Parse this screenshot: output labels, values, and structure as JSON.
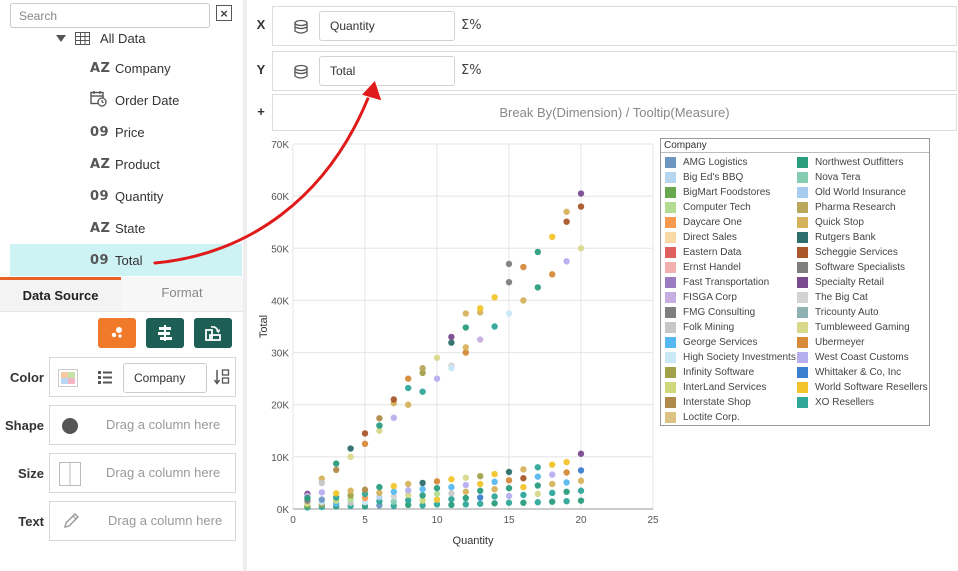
{
  "sidebar": {
    "search_placeholder": "Search",
    "clear_glyph": "×",
    "root_label": "All Data",
    "fields": [
      {
        "icon": "AZ",
        "label": "Company"
      },
      {
        "icon": "cal",
        "label": "Order Date"
      },
      {
        "icon": "09",
        "label": "Price"
      },
      {
        "icon": "AZ",
        "label": "Product"
      },
      {
        "icon": "09",
        "label": "Quantity"
      },
      {
        "icon": "AZ",
        "label": "State"
      },
      {
        "icon": "09",
        "label": "Total"
      }
    ]
  },
  "tabs": {
    "data_source": "Data Source",
    "format": "Format"
  },
  "props": {
    "color_label": "Color",
    "color_value": "Company",
    "shape_label": "Shape",
    "size_label": "Size",
    "text_label": "Text",
    "drag_hint": "Drag a column here"
  },
  "shelves": {
    "x_key": "X",
    "x_value": "Quantity",
    "y_key": "Y",
    "y_value": "Total",
    "plus_key": "+",
    "agg_glyph": "Σ%",
    "breakby": "Break By(Dimension) / Tooltip(Measure)"
  },
  "chart_data": {
    "type": "scatter",
    "xlabel": "Quantity",
    "ylabel": "Total",
    "xlim": [
      0,
      25
    ],
    "ylim": [
      0,
      70000
    ],
    "x_ticks": [
      "0",
      "5",
      "10",
      "15",
      "20",
      "25"
    ],
    "y_ticks": [
      "0K",
      "10K",
      "20K",
      "30K",
      "40K",
      "50K",
      "60K",
      "70K"
    ],
    "grid": true,
    "legend_title": "Company",
    "legend_placement": "right",
    "legend": [
      {
        "name": "AMG Logistics",
        "color": "#6c97c1"
      },
      {
        "name": "Big Ed's BBQ",
        "color": "#b6d5ee"
      },
      {
        "name": "BigMart Foodstores",
        "color": "#6aa84f"
      },
      {
        "name": "Computer Tech",
        "color": "#b3dc93"
      },
      {
        "name": "Daycare One",
        "color": "#f79a52"
      },
      {
        "name": "Direct Sales",
        "color": "#f9d9a6"
      },
      {
        "name": "Eastern Data",
        "color": "#e06060"
      },
      {
        "name": "Ernst Handel",
        "color": "#f2b0ae"
      },
      {
        "name": "Fast Transportation",
        "color": "#9b7cc2"
      },
      {
        "name": "FISGA Corp",
        "color": "#c8aee0"
      },
      {
        "name": "FMG Consulting",
        "color": "#7f7f7f"
      },
      {
        "name": "Folk Mining",
        "color": "#c7c7c7"
      },
      {
        "name": "George Services",
        "color": "#59b8ef"
      },
      {
        "name": "High Society Investments",
        "color": "#c9e9f6"
      },
      {
        "name": "Infinity Software",
        "color": "#a1a14a"
      },
      {
        "name": "InterLand Services",
        "color": "#cfd97c"
      },
      {
        "name": "Interstate Shop",
        "color": "#b08a4a"
      },
      {
        "name": "Loctite Corp.",
        "color": "#dcc383"
      },
      {
        "name": "Northwest Outfitters",
        "color": "#2a9d7f"
      },
      {
        "name": "Nova Tera",
        "color": "#85cdb2"
      },
      {
        "name": "Old World Insurance",
        "color": "#a7ccef"
      },
      {
        "name": "Pharma Research",
        "color": "#b9a85b"
      },
      {
        "name": "Quick Stop",
        "color": "#d6b25c"
      },
      {
        "name": "Rutgers Bank",
        "color": "#2e6e6a"
      },
      {
        "name": "Scheggie Services",
        "color": "#a9572b"
      },
      {
        "name": "Software Specialists",
        "color": "#7e7e7e"
      },
      {
        "name": "Specialty Retail",
        "color": "#7a4c8f"
      },
      {
        "name": "The Big Cat",
        "color": "#d3d3d3"
      },
      {
        "name": "Tricounty Auto",
        "color": "#8fb1b1"
      },
      {
        "name": "Tumbleweed Gaming",
        "color": "#d8d88c"
      },
      {
        "name": "Ubermeyer",
        "color": "#d68a3a"
      },
      {
        "name": "West Coast Customs",
        "color": "#b7aef0"
      },
      {
        "name": "Whittaker & Co, Inc",
        "color": "#3b7fd1"
      },
      {
        "name": "World Software Resellers",
        "color": "#f2c42a"
      },
      {
        "name": "XO Resellers",
        "color": "#2fa89a"
      }
    ],
    "points": [
      {
        "x": 1,
        "y": 2900,
        "c": "#7a4c8f"
      },
      {
        "x": 2,
        "y": 5800,
        "c": "#d6b25c"
      },
      {
        "x": 3,
        "y": 8700,
        "c": "#2a9d7f"
      },
      {
        "x": 4,
        "y": 11600,
        "c": "#2e6e6a"
      },
      {
        "x": 5,
        "y": 14500,
        "c": "#a9572b"
      },
      {
        "x": 6,
        "y": 17400,
        "c": "#b08a4a"
      },
      {
        "x": 7,
        "y": 20300,
        "c": "#d6b25c"
      },
      {
        "x": 8,
        "y": 23200,
        "c": "#2fa89a"
      },
      {
        "x": 9,
        "y": 26100,
        "c": "#a1a14a"
      },
      {
        "x": 10,
        "y": 29000,
        "c": "#d8d88c"
      },
      {
        "x": 11,
        "y": 31900,
        "c": "#2e6e6a"
      },
      {
        "x": 12,
        "y": 34800,
        "c": "#2a9d7f"
      },
      {
        "x": 13,
        "y": 37700,
        "c": "#d6b25c"
      },
      {
        "x": 14,
        "y": 40600,
        "c": "#f2c42a"
      },
      {
        "x": 15,
        "y": 43500,
        "c": "#7e7e7e"
      },
      {
        "x": 16,
        "y": 46400,
        "c": "#d68a3a"
      },
      {
        "x": 17,
        "y": 49300,
        "c": "#2a9d7f"
      },
      {
        "x": 18,
        "y": 52200,
        "c": "#f2c42a"
      },
      {
        "x": 19,
        "y": 55100,
        "c": "#a9572b"
      },
      {
        "x": 20,
        "y": 58000,
        "c": "#a9572b"
      },
      {
        "x": 1,
        "y": 2500,
        "c": "#c8aee0"
      },
      {
        "x": 2,
        "y": 5000,
        "c": "#c7c7c7"
      },
      {
        "x": 3,
        "y": 7500,
        "c": "#b08a4a"
      },
      {
        "x": 4,
        "y": 10000,
        "c": "#d8d88c"
      },
      {
        "x": 5,
        "y": 12500,
        "c": "#d68a3a"
      },
      {
        "x": 6,
        "y": 15000,
        "c": "#d8d88c"
      },
      {
        "x": 7,
        "y": 17500,
        "c": "#b7aef0"
      },
      {
        "x": 8,
        "y": 20000,
        "c": "#d6b25c"
      },
      {
        "x": 9,
        "y": 22500,
        "c": "#2fa89a"
      },
      {
        "x": 10,
        "y": 25000,
        "c": "#b7aef0"
      },
      {
        "x": 11,
        "y": 27500,
        "c": "#d3d3d3"
      },
      {
        "x": 12,
        "y": 30000,
        "c": "#d68a3a"
      },
      {
        "x": 13,
        "y": 32500,
        "c": "#c8aee0"
      },
      {
        "x": 14,
        "y": 35000,
        "c": "#2fa89a"
      },
      {
        "x": 15,
        "y": 37500,
        "c": "#c9e9f6"
      },
      {
        "x": 16,
        "y": 40000,
        "c": "#d6b25c"
      },
      {
        "x": 17,
        "y": 42500,
        "c": "#2a9d7f"
      },
      {
        "x": 18,
        "y": 45000,
        "c": "#d68a3a"
      },
      {
        "x": 19,
        "y": 47500,
        "c": "#b7aef0"
      },
      {
        "x": 20,
        "y": 50000,
        "c": "#d8d88c"
      },
      {
        "x": 11,
        "y": 33000,
        "c": "#7a4c8f"
      },
      {
        "x": 12,
        "y": 37500,
        "c": "#d6b25c"
      },
      {
        "x": 15,
        "y": 47000,
        "c": "#7e7e7e"
      },
      {
        "x": 20,
        "y": 60500,
        "c": "#7a4c8f"
      },
      {
        "x": 11,
        "y": 27000,
        "c": "#c9e9f6"
      },
      {
        "x": 9,
        "y": 27000,
        "c": "#b9a85b"
      },
      {
        "x": 8,
        "y": 25000,
        "c": "#d68a3a"
      },
      {
        "x": 7,
        "y": 21000,
        "c": "#a9572b"
      },
      {
        "x": 12,
        "y": 31000,
        "c": "#d6b25c"
      },
      {
        "x": 6,
        "y": 16000,
        "c": "#2a9d7f"
      },
      {
        "x": 19,
        "y": 57000,
        "c": "#d6b25c"
      },
      {
        "x": 13,
        "y": 38500,
        "c": "#f2c42a"
      },
      {
        "x": 1,
        "y": 300,
        "c": "#2fa89a"
      },
      {
        "x": 1,
        "y": 600,
        "c": "#6aa84f"
      },
      {
        "x": 1,
        "y": 1000,
        "c": "#d8d88c"
      },
      {
        "x": 1,
        "y": 1600,
        "c": "#7e7e7e"
      },
      {
        "x": 1,
        "y": 2100,
        "c": "#2a9d7f"
      },
      {
        "x": 2,
        "y": 400,
        "c": "#2fa89a"
      },
      {
        "x": 2,
        "y": 900,
        "c": "#a1a14a"
      },
      {
        "x": 2,
        "y": 1300,
        "c": "#c9e9f6"
      },
      {
        "x": 2,
        "y": 1800,
        "c": "#6c97c1"
      },
      {
        "x": 2,
        "y": 3200,
        "c": "#b7aef0"
      },
      {
        "x": 3,
        "y": 500,
        "c": "#2a9d7f"
      },
      {
        "x": 3,
        "y": 1000,
        "c": "#59b8ef"
      },
      {
        "x": 3,
        "y": 1600,
        "c": "#cfd97c"
      },
      {
        "x": 3,
        "y": 2200,
        "c": "#2fa89a"
      },
      {
        "x": 3,
        "y": 3000,
        "c": "#f2c42a"
      },
      {
        "x": 4,
        "y": 600,
        "c": "#2fa89a"
      },
      {
        "x": 4,
        "y": 1200,
        "c": "#c7c7c7"
      },
      {
        "x": 4,
        "y": 1900,
        "c": "#b3dc93"
      },
      {
        "x": 4,
        "y": 2600,
        "c": "#a1a14a"
      },
      {
        "x": 4,
        "y": 3500,
        "c": "#d6b25c"
      },
      {
        "x": 5,
        "y": 500,
        "c": "#2a9d7f"
      },
      {
        "x": 5,
        "y": 1300,
        "c": "#c9e9f6"
      },
      {
        "x": 5,
        "y": 2100,
        "c": "#f79a52"
      },
      {
        "x": 5,
        "y": 2900,
        "c": "#2fa89a"
      },
      {
        "x": 5,
        "y": 3700,
        "c": "#b08a4a"
      },
      {
        "x": 6,
        "y": 700,
        "c": "#6c97c1"
      },
      {
        "x": 6,
        "y": 1500,
        "c": "#2fa89a"
      },
      {
        "x": 6,
        "y": 2300,
        "c": "#b6d5ee"
      },
      {
        "x": 6,
        "y": 3100,
        "c": "#d6b25c"
      },
      {
        "x": 6,
        "y": 4200,
        "c": "#2a9d7f"
      },
      {
        "x": 7,
        "y": 600,
        "c": "#2fa89a"
      },
      {
        "x": 7,
        "y": 1400,
        "c": "#85cdb2"
      },
      {
        "x": 7,
        "y": 2400,
        "c": "#d3d3d3"
      },
      {
        "x": 7,
        "y": 3300,
        "c": "#59b8ef"
      },
      {
        "x": 7,
        "y": 4400,
        "c": "#f2c42a"
      },
      {
        "x": 8,
        "y": 800,
        "c": "#2a9d7f"
      },
      {
        "x": 8,
        "y": 1700,
        "c": "#2fa89a"
      },
      {
        "x": 8,
        "y": 2700,
        "c": "#d8d88c"
      },
      {
        "x": 8,
        "y": 3600,
        "c": "#b7aef0"
      },
      {
        "x": 8,
        "y": 4800,
        "c": "#d6b25c"
      },
      {
        "x": 9,
        "y": 700,
        "c": "#2fa89a"
      },
      {
        "x": 9,
        "y": 1600,
        "c": "#cfd97c"
      },
      {
        "x": 9,
        "y": 2600,
        "c": "#2a9d7f"
      },
      {
        "x": 9,
        "y": 3800,
        "c": "#59b8ef"
      },
      {
        "x": 9,
        "y": 5000,
        "c": "#2e6e6a"
      },
      {
        "x": 10,
        "y": 900,
        "c": "#2fa89a"
      },
      {
        "x": 10,
        "y": 1800,
        "c": "#f2c42a"
      },
      {
        "x": 10,
        "y": 2900,
        "c": "#b3dc93"
      },
      {
        "x": 10,
        "y": 4000,
        "c": "#2a9d7f"
      },
      {
        "x": 10,
        "y": 5300,
        "c": "#d68a3a"
      },
      {
        "x": 11,
        "y": 800,
        "c": "#2a9d7f"
      },
      {
        "x": 11,
        "y": 1900,
        "c": "#2fa89a"
      },
      {
        "x": 11,
        "y": 3000,
        "c": "#c7c7c7"
      },
      {
        "x": 11,
        "y": 4200,
        "c": "#59b8ef"
      },
      {
        "x": 11,
        "y": 5700,
        "c": "#f2c42a"
      },
      {
        "x": 12,
        "y": 900,
        "c": "#2fa89a"
      },
      {
        "x": 12,
        "y": 2100,
        "c": "#2a9d7f"
      },
      {
        "x": 12,
        "y": 3300,
        "c": "#d6b25c"
      },
      {
        "x": 12,
        "y": 4600,
        "c": "#b7aef0"
      },
      {
        "x": 12,
        "y": 6000,
        "c": "#d8d88c"
      },
      {
        "x": 13,
        "y": 1000,
        "c": "#2fa89a"
      },
      {
        "x": 13,
        "y": 2200,
        "c": "#3b7fd1"
      },
      {
        "x": 13,
        "y": 3500,
        "c": "#2a9d7f"
      },
      {
        "x": 13,
        "y": 4800,
        "c": "#f2c42a"
      },
      {
        "x": 13,
        "y": 6300,
        "c": "#a1a14a"
      },
      {
        "x": 14,
        "y": 1100,
        "c": "#2a9d7f"
      },
      {
        "x": 14,
        "y": 2400,
        "c": "#2fa89a"
      },
      {
        "x": 14,
        "y": 3800,
        "c": "#d6b25c"
      },
      {
        "x": 14,
        "y": 5200,
        "c": "#59b8ef"
      },
      {
        "x": 14,
        "y": 6700,
        "c": "#f2c42a"
      },
      {
        "x": 15,
        "y": 1200,
        "c": "#2fa89a"
      },
      {
        "x": 15,
        "y": 2500,
        "c": "#b7aef0"
      },
      {
        "x": 15,
        "y": 4000,
        "c": "#2a9d7f"
      },
      {
        "x": 15,
        "y": 5500,
        "c": "#d68a3a"
      },
      {
        "x": 15,
        "y": 7100,
        "c": "#2e6e6a"
      },
      {
        "x": 16,
        "y": 1200,
        "c": "#2a9d7f"
      },
      {
        "x": 16,
        "y": 2700,
        "c": "#2fa89a"
      },
      {
        "x": 16,
        "y": 4200,
        "c": "#f2c42a"
      },
      {
        "x": 16,
        "y": 5900,
        "c": "#a9572b"
      },
      {
        "x": 16,
        "y": 7600,
        "c": "#d6b25c"
      },
      {
        "x": 17,
        "y": 1300,
        "c": "#2fa89a"
      },
      {
        "x": 17,
        "y": 2900,
        "c": "#d8d88c"
      },
      {
        "x": 17,
        "y": 4500,
        "c": "#2a9d7f"
      },
      {
        "x": 17,
        "y": 6200,
        "c": "#59b8ef"
      },
      {
        "x": 17,
        "y": 8000,
        "c": "#2fa89a"
      },
      {
        "x": 18,
        "y": 1400,
        "c": "#2a9d7f"
      },
      {
        "x": 18,
        "y": 3100,
        "c": "#2fa89a"
      },
      {
        "x": 18,
        "y": 4800,
        "c": "#d6b25c"
      },
      {
        "x": 18,
        "y": 6600,
        "c": "#b7aef0"
      },
      {
        "x": 18,
        "y": 8500,
        "c": "#f2c42a"
      },
      {
        "x": 19,
        "y": 1500,
        "c": "#2fa89a"
      },
      {
        "x": 19,
        "y": 3300,
        "c": "#2a9d7f"
      },
      {
        "x": 19,
        "y": 5100,
        "c": "#59b8ef"
      },
      {
        "x": 19,
        "y": 7000,
        "c": "#d68a3a"
      },
      {
        "x": 19,
        "y": 9000,
        "c": "#f2c42a"
      },
      {
        "x": 20,
        "y": 1600,
        "c": "#2a9d7f"
      },
      {
        "x": 20,
        "y": 3500,
        "c": "#2fa89a"
      },
      {
        "x": 20,
        "y": 5400,
        "c": "#d6b25c"
      },
      {
        "x": 20,
        "y": 7400,
        "c": "#3b7fd1"
      },
      {
        "x": 20,
        "y": 10600,
        "c": "#7a4c8f"
      }
    ]
  }
}
